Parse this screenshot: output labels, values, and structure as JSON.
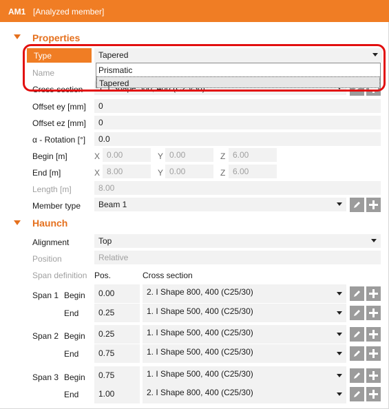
{
  "header": {
    "id": "AM1",
    "name": "[Analyzed member]"
  },
  "properties": {
    "section_title": "Properties",
    "type": {
      "label": "Type",
      "value": "Tapered",
      "options": [
        "Prismatic",
        "Tapered"
      ],
      "highlighted": "Tapered"
    },
    "name": {
      "label": "Name"
    },
    "cross_section": {
      "label": "Cross-section",
      "value": "1. I Shape 500, 400 (C25/30)"
    },
    "offset_ey": {
      "label": "Offset ey [mm]",
      "value": "0"
    },
    "offset_ez": {
      "label": "Offset ez [mm]",
      "value": "0"
    },
    "rotation": {
      "label": "α - Rotation [°]",
      "value": "0.0"
    },
    "begin": {
      "label": "Begin [m]",
      "x_axis": "X",
      "x": "0.00",
      "y_axis": "Y",
      "y": "0.00",
      "z_axis": "Z",
      "z": "6.00"
    },
    "end": {
      "label": "End [m]",
      "x_axis": "X",
      "x": "8.00",
      "y_axis": "Y",
      "y": "0.00",
      "z_axis": "Z",
      "z": "6.00"
    },
    "length": {
      "label": "Length [m]",
      "value": "8.00"
    },
    "member_type": {
      "label": "Member type",
      "value": "Beam 1"
    }
  },
  "haunch": {
    "section_title": "Haunch",
    "alignment": {
      "label": "Alignment",
      "value": "Top"
    },
    "position": {
      "label": "Position",
      "value": "Relative"
    },
    "span_definition": {
      "label": "Span definition",
      "pos_header": "Pos.",
      "cs_header": "Cross section"
    },
    "spans": [
      {
        "span": "Span 1",
        "begin_label": "Begin",
        "begin_pos": "0.00",
        "begin_cs": "2. I Shape 800, 400 (C25/30)",
        "end_label": "End",
        "end_pos": "0.25",
        "end_cs": "1. I Shape 500, 400 (C25/30)"
      },
      {
        "span": "Span 2",
        "begin_label": "Begin",
        "begin_pos": "0.25",
        "begin_cs": "1. I Shape 500, 400 (C25/30)",
        "end_label": "End",
        "end_pos": "0.75",
        "end_cs": "1. I Shape 500, 400 (C25/30)"
      },
      {
        "span": "Span 3",
        "begin_label": "Begin",
        "begin_pos": "0.75",
        "begin_cs": "1. I Shape 500, 400 (C25/30)",
        "end_label": "End",
        "end_pos": "1.00",
        "end_cs": "2. I Shape 800, 400 (C25/30)"
      }
    ]
  },
  "icons": {
    "edit": "pencil-icon",
    "add": "plus-icon",
    "collapse": "triangle-down-icon",
    "dropdown": "chevron-down-icon"
  },
  "colors": {
    "accent": "#f07d24",
    "highlight_box": "#e20f0f",
    "field_bg": "#f2f2f2",
    "button_bg": "#9c9c9c"
  }
}
